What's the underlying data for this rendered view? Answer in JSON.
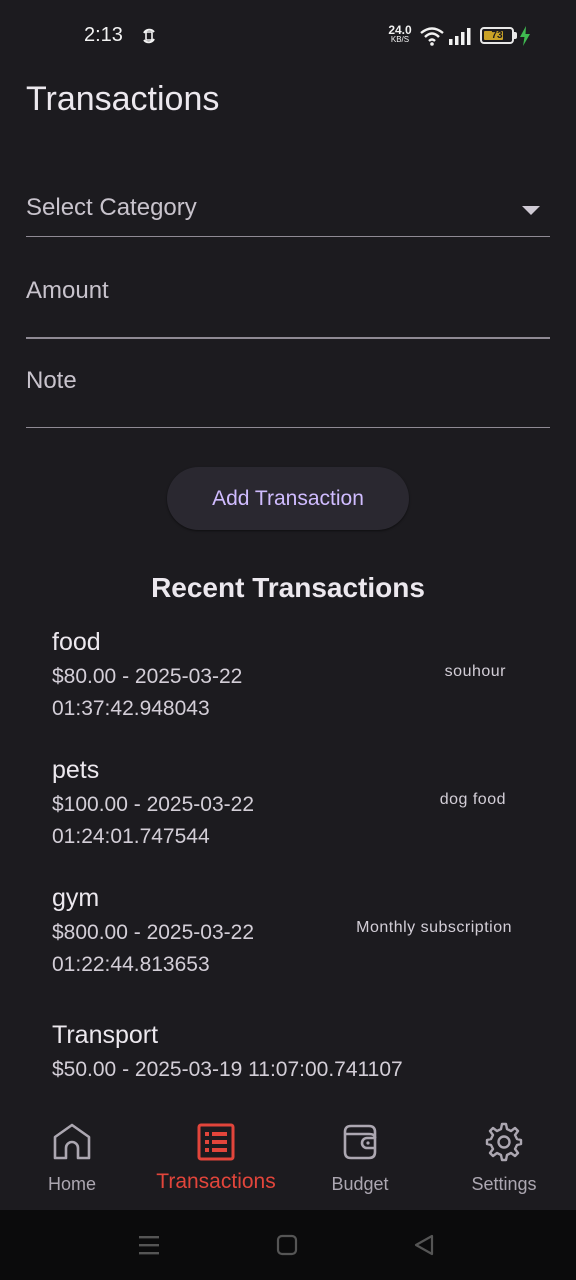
{
  "status_bar": {
    "time": "2:13",
    "net_speed": "24.0",
    "net_unit": "KB/S",
    "battery_level": "73",
    "battery_fraction": 0.73,
    "icons": [
      "sync-icon",
      "wifi-icon",
      "signal-icon",
      "battery-icon",
      "charging-icon"
    ]
  },
  "page": {
    "title": "Transactions"
  },
  "form": {
    "category_placeholder": "Select Category",
    "amount_placeholder": "Amount",
    "note_placeholder": "Note",
    "add_button": "Add Transaction"
  },
  "recent": {
    "title": "Recent Transactions",
    "items": [
      {
        "category": "food",
        "detail": "$80.00 - 2025-03-22 01:37:42.948043",
        "note": "souhour"
      },
      {
        "category": "pets",
        "detail": "$100.00 - 2025-03-22 01:24:01.747544",
        "note": "dog food"
      },
      {
        "category": "gym",
        "detail": "$800.00 - 2025-03-22 01:22:44.813653",
        "note": "Monthly subscription"
      },
      {
        "category": "Transport",
        "detail": "$50.00 - 2025-03-19 11:07:00.741107",
        "note": ""
      }
    ]
  },
  "nav": {
    "items": [
      {
        "label": "Home",
        "icon": "home-icon",
        "active": false
      },
      {
        "label": "Transactions",
        "icon": "list-icon",
        "active": true
      },
      {
        "label": "Budget",
        "icon": "wallet-icon",
        "active": false
      },
      {
        "label": "Settings",
        "icon": "gear-icon",
        "active": false
      }
    ]
  },
  "colors": {
    "background": "#1c1b1f",
    "accent": "#d0bcff",
    "active_nav": "#e2453b"
  }
}
